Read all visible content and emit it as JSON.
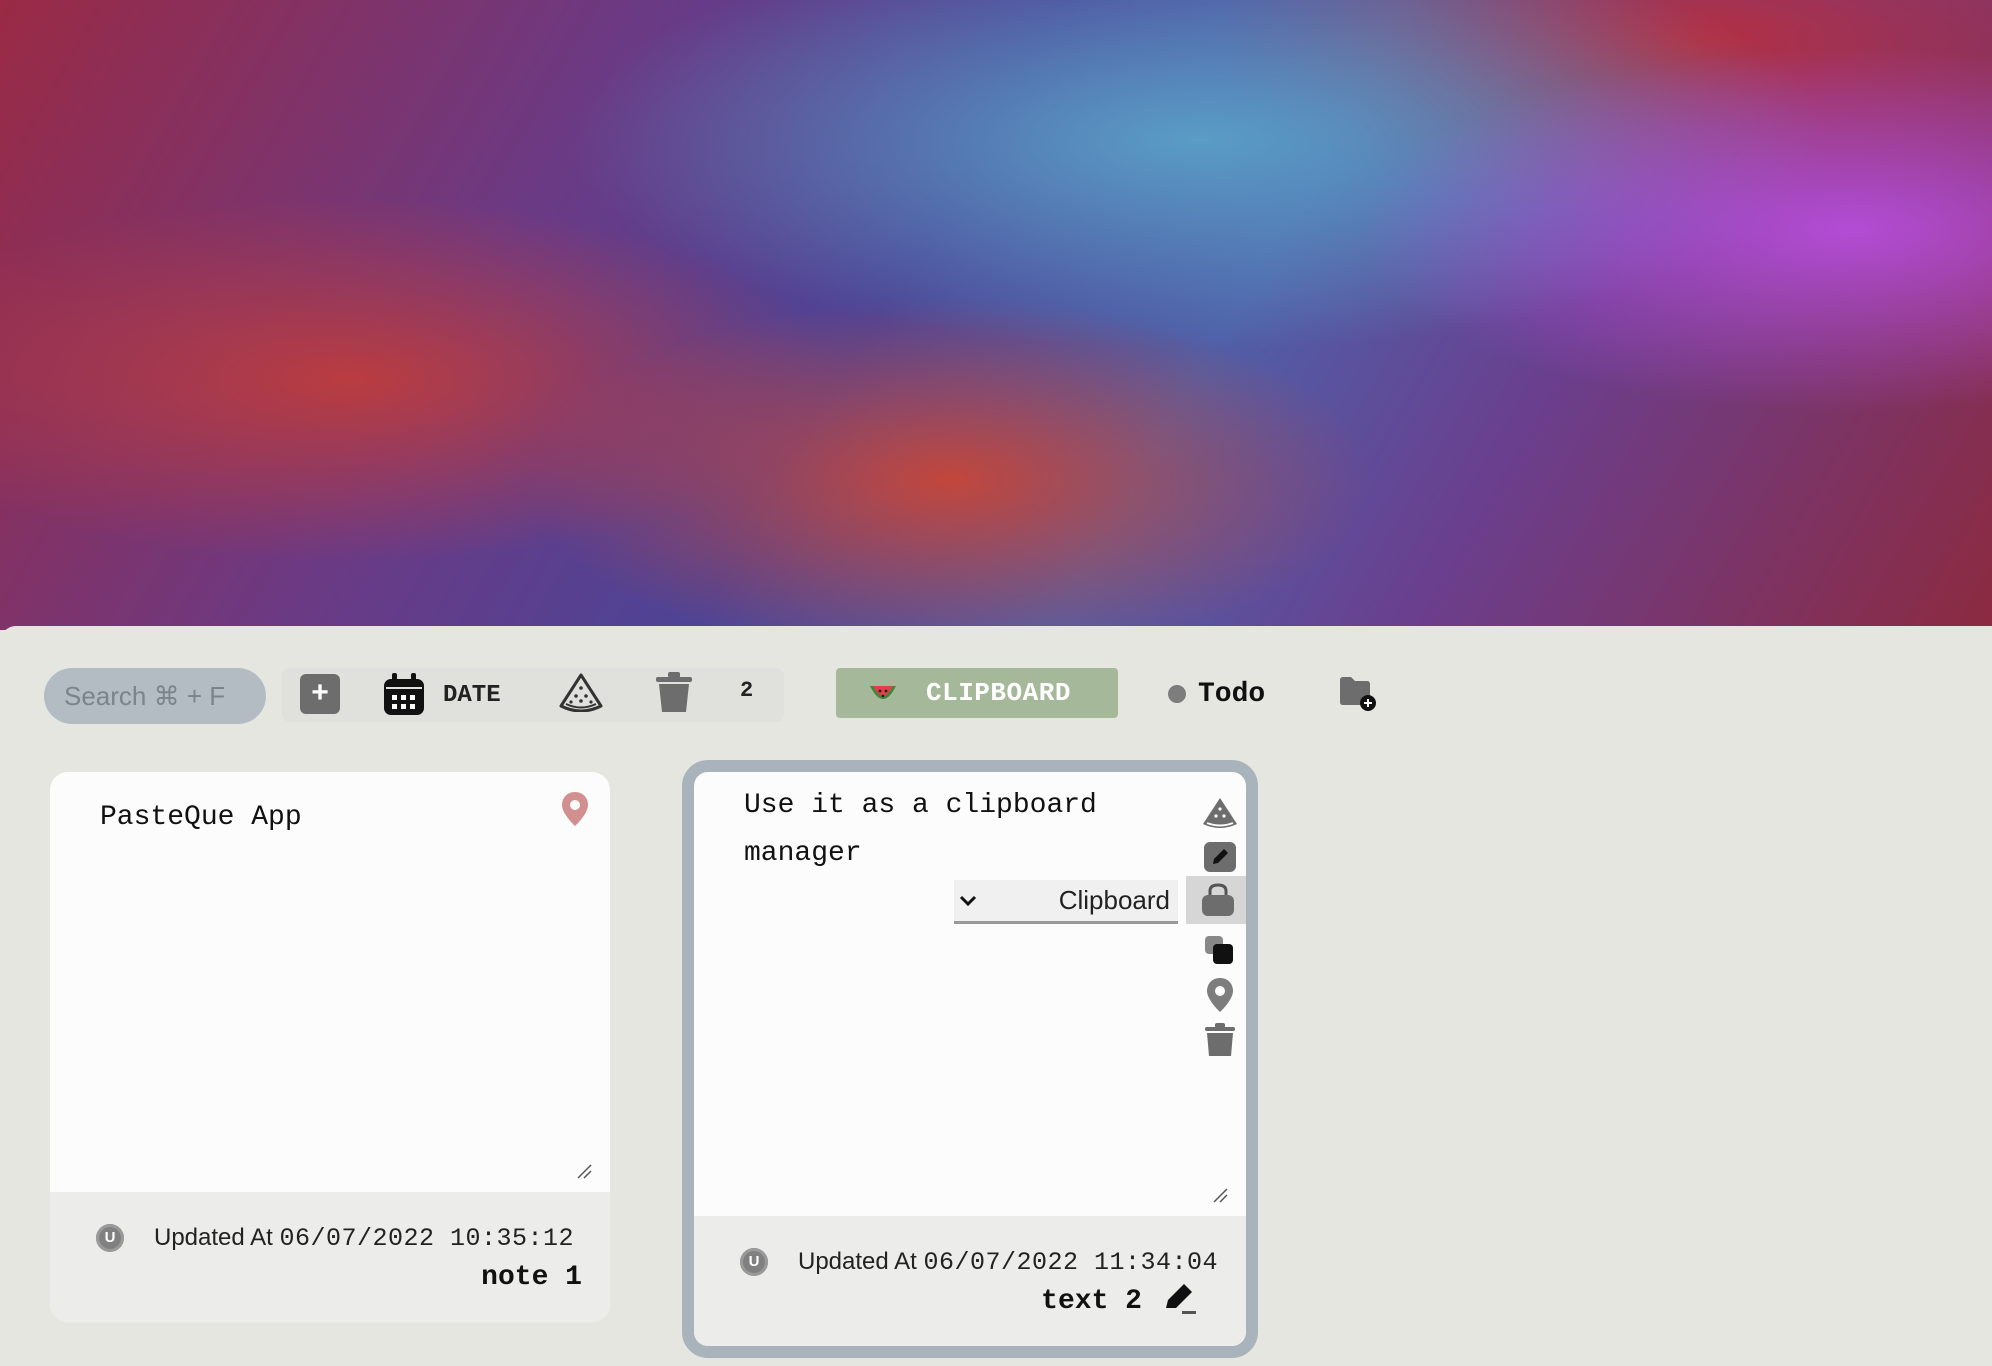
{
  "toolbar": {
    "search_placeholder": "Search ⌘ + F",
    "add_label": "+",
    "date_label": "DATE",
    "trash_count": "2",
    "tabs": [
      {
        "label": "CLIPBOARD",
        "icon": "watermelon-icon",
        "active": true,
        "color": "#a6b89a"
      },
      {
        "label": "Todo",
        "icon": "dot-icon",
        "active": false
      }
    ]
  },
  "cards": [
    {
      "text": "PasteQue App",
      "badge": "U",
      "updated_prefix": "Updated At",
      "updated_at": "06/07/2022 10:35:12",
      "name": "note 1",
      "pin_color": "#d28f8f"
    },
    {
      "text": "Use it as a clipboard manager",
      "badge": "U",
      "updated_prefix": "Updated At",
      "updated_at": "06/07/2022 11:34:04",
      "name": "text 2",
      "folder_select": "Clipboard",
      "selected": true,
      "border_color": "#a9b3bc"
    }
  ],
  "colors": {
    "panel_bg": "#e6e6e1",
    "search_bg": "#b3bcc3",
    "icon_gray": "#6d6d6d"
  }
}
